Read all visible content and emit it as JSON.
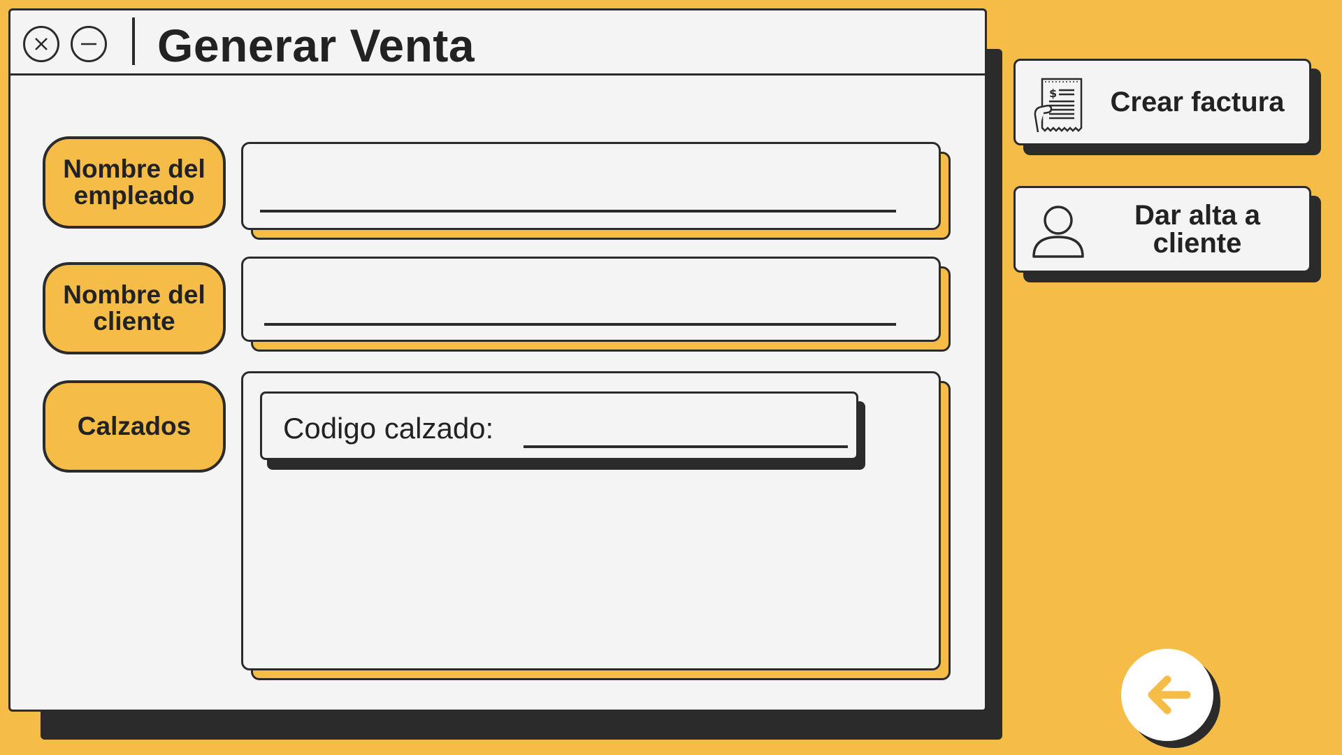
{
  "window": {
    "title": "Generar Venta",
    "close_icon": "close-icon",
    "minimize_icon": "minimize-icon"
  },
  "form": {
    "employee_label": "Nombre del empleado",
    "employee_value": "",
    "client_label": "Nombre del cliente",
    "client_value": "",
    "shoes_label": "Calzados",
    "shoe_code_label": "Codigo calzado:",
    "shoe_code_value": ""
  },
  "sidebar": {
    "create_invoice_label": "Crear factura",
    "create_invoice_icon": "invoice-receipt-icon",
    "add_client_label": "Dar alta a cliente",
    "add_client_icon": "user-icon"
  },
  "back_button": {
    "icon": "arrow-left-icon"
  },
  "colors": {
    "background": "#F5BD47",
    "panel": "#F4F4F4",
    "ink": "#2b2b2b",
    "accent": "#F5BD47"
  }
}
